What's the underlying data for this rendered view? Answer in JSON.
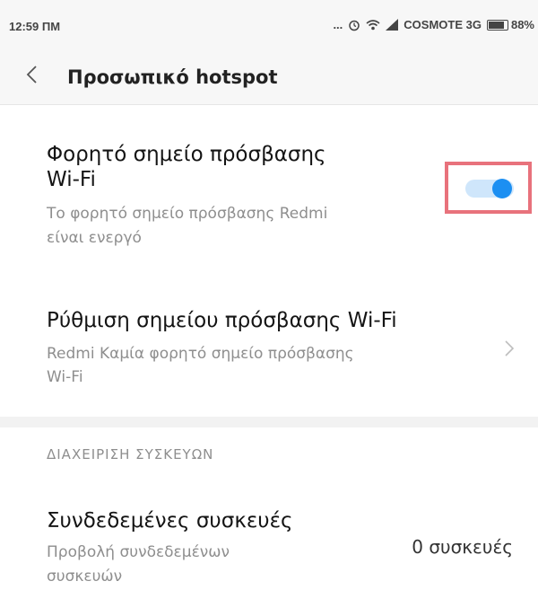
{
  "status_bar": {
    "time": "12:59 ΠΜ",
    "dots": "...",
    "carrier": "COSMOTE 3G",
    "battery": "88%",
    "battery_level": 0.88
  },
  "header": {
    "title": "Προσωπικό hotspot",
    "back_icon": "chevron-left-icon"
  },
  "hotspot": {
    "title_line1": "Φορητό σημείο πρόσβασης",
    "title_line2": "Wi-Fi",
    "subtitle_line1": "Το φορητό σημείο πρόσβασης Redmi",
    "subtitle_line2": "είναι ενεργό",
    "toggle_on": true,
    "accent_color": "#1c8ff2",
    "highlight_color": "#e8727c"
  },
  "setup": {
    "title": "Ρύθμιση σημείου πρόσβασης Wi-Fi",
    "subtitle_line1": "Redmi Καμία φορητό σημείο πρόσβασης",
    "subtitle_line2": "Wi-Fi",
    "chevron_icon": "chevron-right-icon"
  },
  "device_section": {
    "header": "ΔΙΑΧΕΙΡΙΣΗ ΣΥΣΚΕΥΩΝ"
  },
  "devices": {
    "title": "Συνδεδεμένες συσκευές",
    "subtitle_line1": "Προβολή συνδεδεμένων",
    "subtitle_line2": "συσκευών",
    "value": "0 συσκευές"
  }
}
